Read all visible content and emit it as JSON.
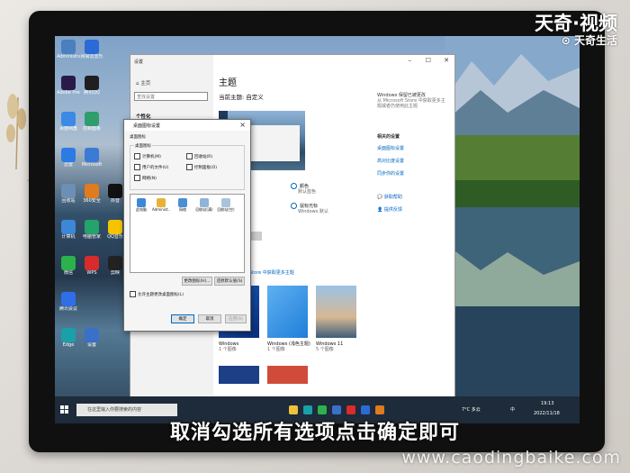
{
  "watermark": {
    "brand_big": "天奇·视频",
    "brand_small": "天奇生活",
    "site": "www.caodingbaike.com"
  },
  "subtitle": "取消勾选所有选项点击确定即可",
  "desktop_icons": [
    {
      "label": "Administrator",
      "color": "#4a7fc0"
    },
    {
      "label": "网易云音乐",
      "color": "#2c6ad6"
    },
    {
      "label": "Adobe Premiere",
      "color": "#2a1a4a"
    },
    {
      "label": "腾讯QQ",
      "color": "#1f1f1f"
    },
    {
      "label": "百度网盘",
      "color": "#3b8ae6"
    },
    {
      "label": "控制面板",
      "color": "#2f9e6c"
    },
    {
      "label": "迅雷",
      "color": "#2c7be5"
    },
    {
      "label": "Microsoft",
      "color": "#3a7bd5"
    },
    {
      "label": "回收站",
      "color": "#6c8fb5"
    },
    {
      "label": "360安全",
      "color": "#e07b20"
    },
    {
      "label": "抖音",
      "color": "#111111"
    },
    {
      "label": "计算机",
      "color": "#3d87d8"
    },
    {
      "label": "电脑管家",
      "color": "#24a36b"
    },
    {
      "label": "QQ音乐",
      "color": "#f5c400"
    },
    {
      "label": "微信",
      "color": "#2bb24c"
    },
    {
      "label": "WPS",
      "color": "#d92b2b"
    },
    {
      "label": "剪映",
      "color": "#222222"
    },
    {
      "label": "腾讯会议",
      "color": "#2e6fe8"
    },
    {
      "label": "Edge",
      "color": "#1aa0a8"
    },
    {
      "label": "设置",
      "color": "#3b70c9"
    }
  ],
  "settings": {
    "window_title": "设置",
    "home": "主页",
    "search_placeholder": "查找设置",
    "section": "个性化",
    "heading": "主题",
    "current_theme": "当前主题: 自定义",
    "options": [
      {
        "title": "颜色",
        "sub": "默认蓝色"
      },
      {
        "title": "鼠标光标",
        "sub": "Windows 默认"
      }
    ],
    "store_link": "Store 中获取更多主题",
    "right_title": "Windows 保留已被更改",
    "right_desc": "从 Microsoft Store 中获取更多主题或者仍使用此主题",
    "related_title": "相关的设置",
    "related_links": [
      "桌面图标设置",
      "高对比度设置",
      "同步你的设置"
    ],
    "help_links": [
      "获取帮助",
      "提供反馈"
    ],
    "tiles": [
      {
        "name": "Windows",
        "count": "1 个图像"
      },
      {
        "name": "Windows (浅色主题)",
        "count": "1 个图像"
      },
      {
        "name": "Windows 11",
        "count": "5 个图像"
      }
    ]
  },
  "dialog": {
    "title": "桌面图标设置",
    "tab": "桌面图标",
    "group_title": "桌面图标",
    "checkboxes": [
      "计算机(M)",
      "回收站(R)",
      "用户的文件(U)",
      "控制面板(O)",
      "网络(N)"
    ],
    "icons": [
      "此电脑",
      "Administ...",
      "网络",
      "回收站(满)",
      "回收站(空)"
    ],
    "change_icon": "更改图标(H)...",
    "restore_default": "还原默认值(S)",
    "allow_theme": "允许主题更改桌面图标(L)",
    "ok": "确定",
    "cancel": "取消",
    "apply": "应用(A)"
  },
  "taskbar": {
    "search_placeholder": "在这里输入你要搜索的内容",
    "weather": "7°C 多云",
    "lang": "中",
    "time": "19:13",
    "date": "2022/11/18"
  }
}
